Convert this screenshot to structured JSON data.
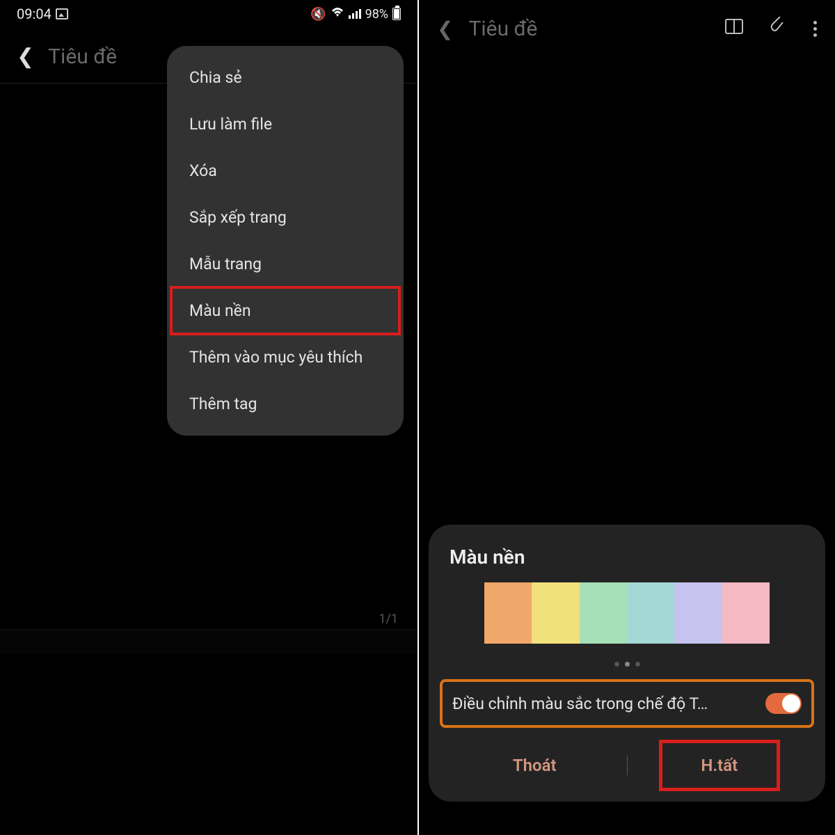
{
  "left": {
    "status": {
      "time": "09:04",
      "battery": "98%"
    },
    "title": "Tiêu đề",
    "menu": [
      "Chia sẻ",
      "Lưu làm file",
      "Xóa",
      "Sắp xếp trang",
      "Mẫu trang",
      "Màu nền",
      "Thêm vào mục yêu thích",
      "Thêm tag"
    ],
    "pagecount": "1/1"
  },
  "right": {
    "title": "Tiêu đề",
    "sheet_title": "Màu nền",
    "swatches": [
      "#f0a76a",
      "#f2e07d",
      "#a6e0b8",
      "#a3d8d6",
      "#c7c3ef",
      "#f4b9c3"
    ],
    "toggle_label": "Điều chỉnh màu sắc trong chế độ T…",
    "action_cancel": "Thoát",
    "action_done": "H.tất"
  }
}
